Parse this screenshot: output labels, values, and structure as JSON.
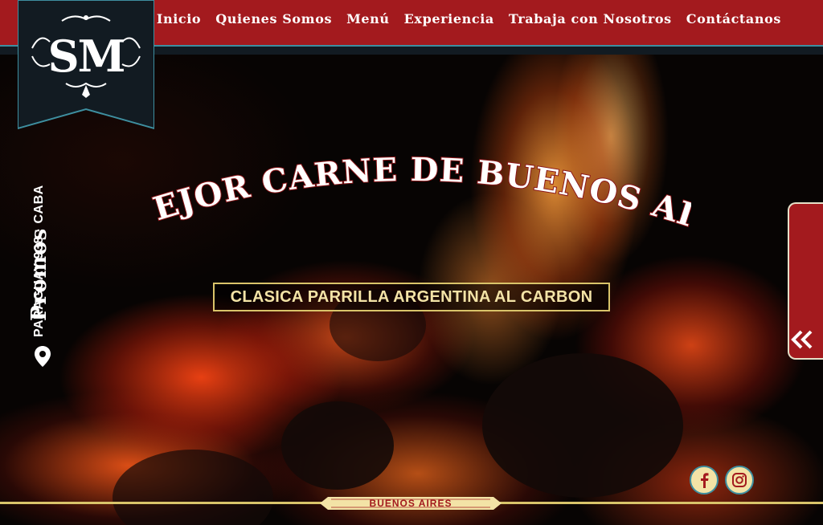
{
  "brand": {
    "logo_text": "SM",
    "colors": {
      "red": "#a31a1e",
      "navy": "#121b22",
      "teal": "#3e8fa0",
      "gold": "#d9c46a",
      "cream": "#f3e3a6"
    }
  },
  "nav": {
    "items": [
      {
        "label": "Inicio"
      },
      {
        "label": "Quienes Somos"
      },
      {
        "label": "Menú"
      },
      {
        "label": "Experiencia"
      },
      {
        "label": "Trabaja con Nosotros"
      },
      {
        "label": "Contáctanos"
      }
    ]
  },
  "address": {
    "text": "PARAGUAY 938 · CABA",
    "icon": "map-pin-icon"
  },
  "hero": {
    "headline": "LA MEJOR CARNE DE BUENOS AIRES",
    "tagline": "CLASICA PARRILLA ARGENTINA AL CARBON"
  },
  "promos": {
    "label": "Promos",
    "icon": "double-chevron-left-icon"
  },
  "social": [
    {
      "name": "facebook",
      "icon": "facebook-icon"
    },
    {
      "name": "instagram",
      "icon": "instagram-icon"
    }
  ],
  "footer": {
    "badge": "BUENOS AIRES"
  }
}
